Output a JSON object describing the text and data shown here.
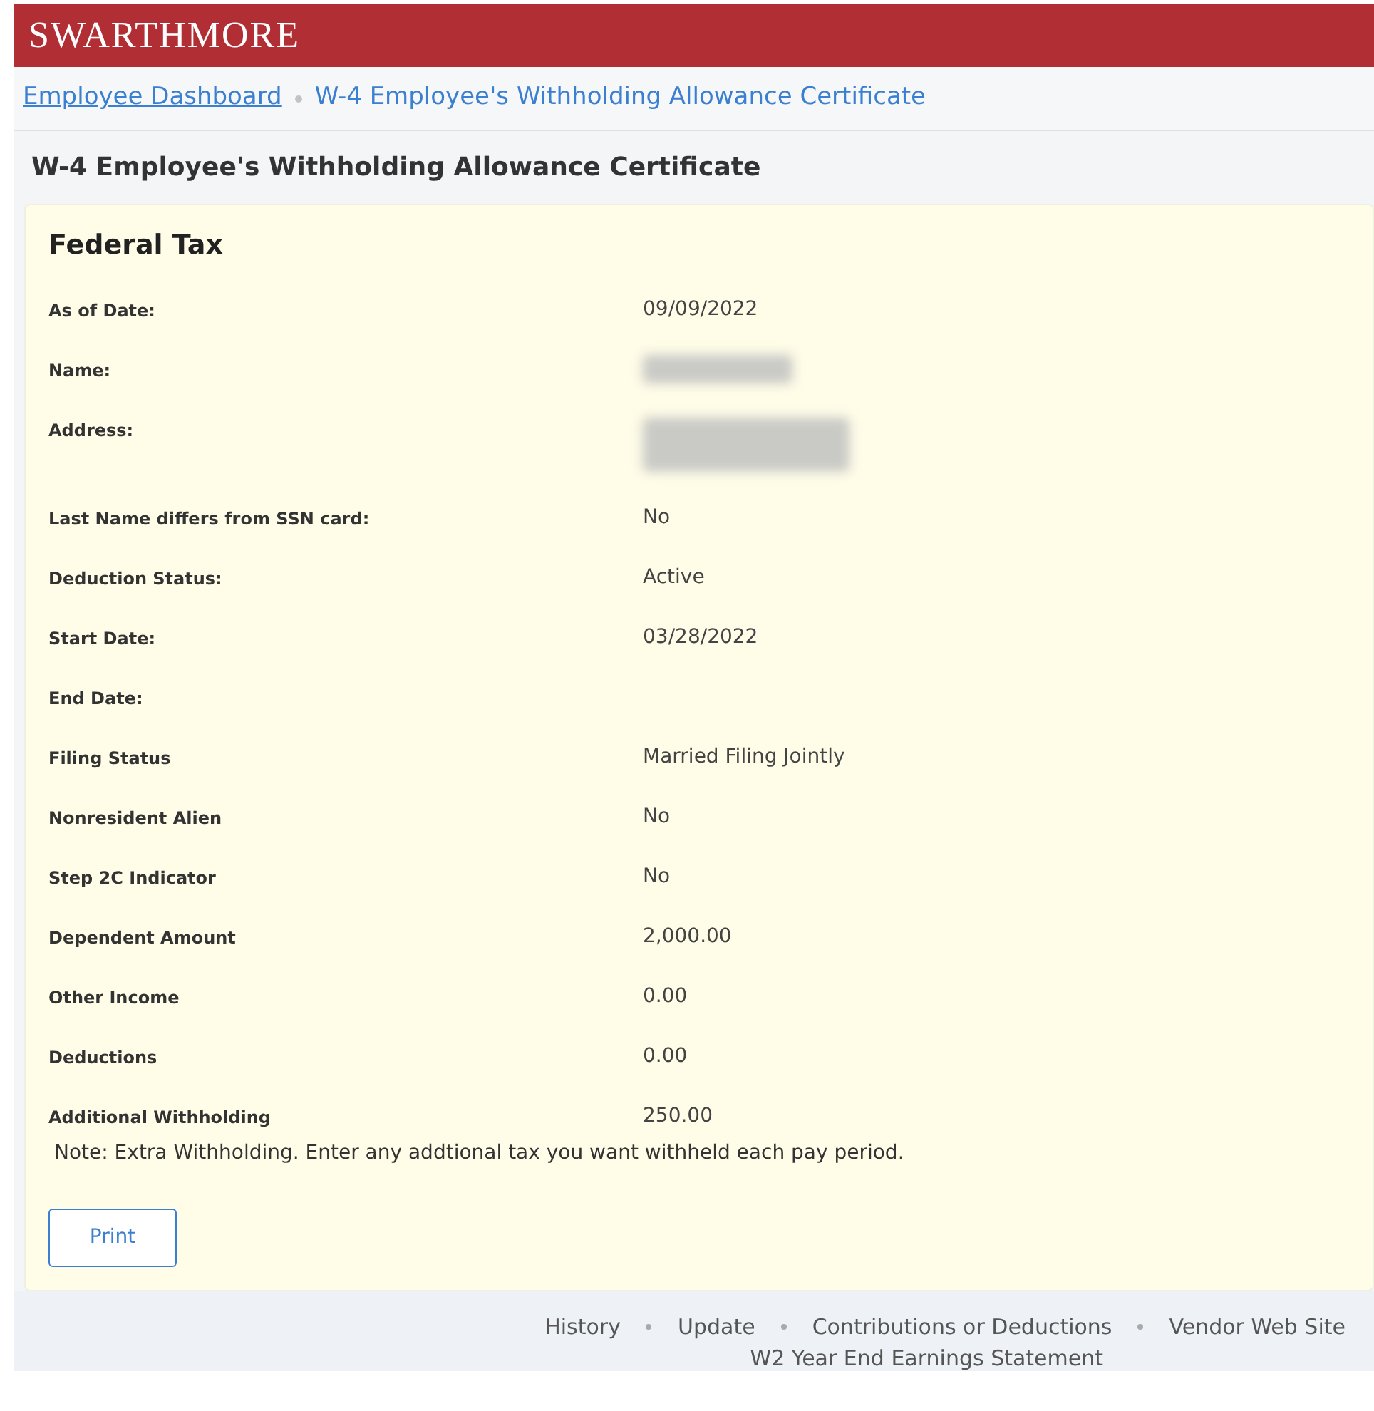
{
  "header": {
    "logo": "SWARTHMORE"
  },
  "breadcrumb": [
    {
      "label": "Employee Dashboard",
      "selected": false
    },
    {
      "label": "W-4 Employee's Withholding Allowance Certificate",
      "selected": true
    }
  ],
  "page_title": "W-4 Employee's Withholding Allowance Certificate",
  "card": {
    "title": "Federal Tax",
    "fields": [
      {
        "label": "As of Date:",
        "kind": "text",
        "value": "09/09/2022"
      },
      {
        "label": "Name:",
        "kind": "redacted"
      },
      {
        "label": "Address:",
        "kind": "redacted_block"
      },
      {
        "label": "Last Name differs from SSN card:",
        "kind": "text",
        "value": "No"
      },
      {
        "label": "Deduction Status:",
        "kind": "text",
        "value": "Active"
      },
      {
        "label": "Start Date:",
        "kind": "text",
        "value": "03/28/2022"
      },
      {
        "label": "End Date:",
        "kind": "empty"
      },
      {
        "label": "Filing Status",
        "kind": "text",
        "value": "Married Filing Jointly"
      },
      {
        "label": "Nonresident Alien",
        "kind": "text",
        "value": "No"
      },
      {
        "label": "Step 2C Indicator",
        "kind": "text",
        "value": "No"
      },
      {
        "label": "Dependent Amount",
        "kind": "text",
        "value": "2,000.00"
      },
      {
        "label": "Other Income",
        "kind": "text",
        "value": "0.00"
      },
      {
        "label": "Deductions",
        "kind": "text",
        "value": "0.00"
      },
      {
        "label": "Additional Withholding",
        "kind": "text",
        "value": "250.00"
      }
    ],
    "note": "Note: Extra Withholding. Enter any addtional tax you want withheld each pay period.",
    "button": "Print"
  },
  "footer_links": [
    "History",
    "Update",
    "Contributions or Deductions",
    "Vendor Web Site",
    "W2 Year End Earnings Statement"
  ]
}
